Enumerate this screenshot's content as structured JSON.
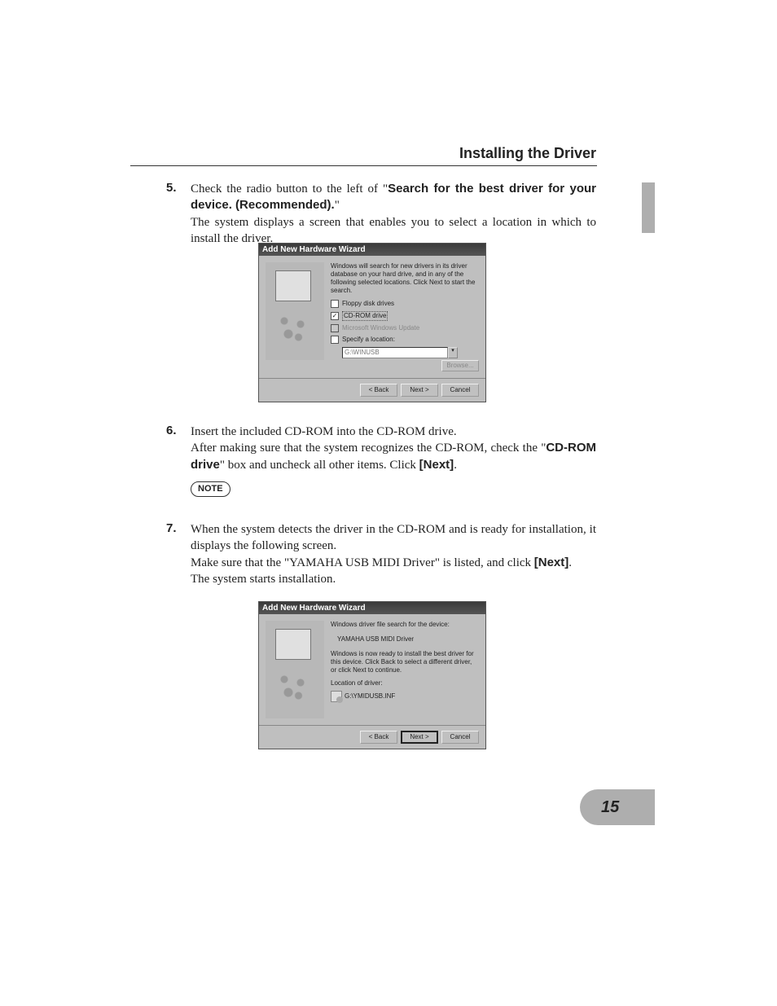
{
  "page": {
    "section_title": "Installing the Driver",
    "page_number": "15"
  },
  "step5": {
    "num": "5.",
    "p1a": "Check the radio button to the left of \"",
    "p1b": "Search for the best driver for your device. (Recommended).",
    "p1c": "\"",
    "p2": "The system displays a screen that enables you to select a location in which to install the driver."
  },
  "step6": {
    "num": "6.",
    "p1": "Insert the included CD-ROM into the CD-ROM drive.",
    "p2a": "After making sure that the system recognizes the CD-ROM, check the \"",
    "p2b": "CD-ROM drive",
    "p2c": "\" box and uncheck all other items. Click ",
    "p2d": "[Next]",
    "p2e": ".",
    "note": "NOTE"
  },
  "step7": {
    "num": "7.",
    "p1": "When the system detects the driver in the CD-ROM and is ready for installation, it displays the following screen.",
    "p2a": "Make sure that the \"YAMAHA USB MIDI Driver\" is listed, and click ",
    "p2b": "[Next]",
    "p2c": ".",
    "p3": "The system starts installation."
  },
  "dialog1": {
    "title": "Add New Hardware Wizard",
    "desc": "Windows will search for new drivers in its driver database on your hard drive, and in any of the following selected locations. Click Next to start the search.",
    "chk_floppy": "Floppy disk drives",
    "chk_cdrom": "CD-ROM drive",
    "chk_update": "Microsoft Windows Update",
    "chk_specify": "Specify a location:",
    "loc_value": "G:\\WINUSB",
    "browse": "Browse...",
    "back": "< Back",
    "next": "Next >",
    "cancel": "Cancel"
  },
  "dialog2": {
    "title": "Add New Hardware Wizard",
    "line1": "Windows driver file search for the device:",
    "driver_name": "YAMAHA USB MIDI Driver",
    "desc": "Windows is now ready to install the best driver for this device. Click Back to select a different driver, or click Next to continue.",
    "loc_label": "Location of driver:",
    "loc_value": "G:\\YMIDUSB.INF",
    "back": "< Back",
    "next": "Next >",
    "cancel": "Cancel"
  }
}
